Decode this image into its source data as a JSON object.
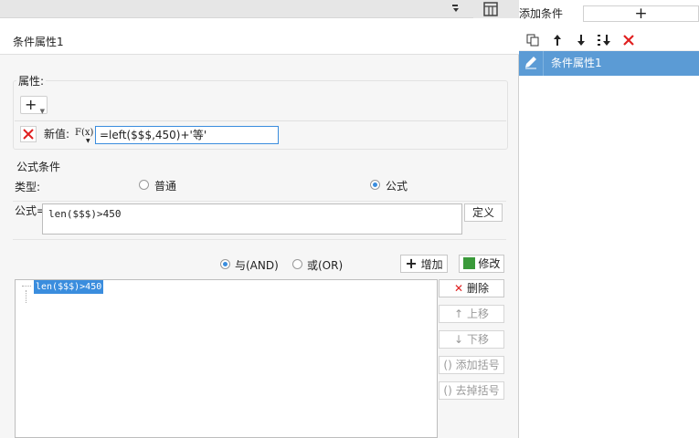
{
  "panel": {
    "title": "条件属性1"
  },
  "attributes": {
    "group_label": "属性:",
    "add_symbol": "+",
    "new_value_label": "新值:",
    "fx_label": "F(x)",
    "new_value_formula": "=left($$$,450)+'等'"
  },
  "formula_condition": {
    "group_label": "公式条件",
    "type_label": "类型:",
    "type_options": [
      "普通",
      "公式"
    ],
    "selected_type": "公式",
    "formula_label": "公式=",
    "formula_value": "len($$$)>450",
    "define_button": "定义",
    "logic_options": [
      "与(AND)",
      "或(OR)"
    ],
    "selected_logic": "与(AND)",
    "add_button": "增加",
    "edit_button": "修改",
    "conditions": [
      "len($$$)>450"
    ],
    "side_buttons": {
      "delete": "删除",
      "move_up": "上移",
      "move_down": "下移",
      "add_parentheses": "添加括号",
      "remove_parentheses": "去掉括号"
    }
  },
  "right_panel": {
    "add_condition_label": "添加条件",
    "add_symbol": "+",
    "items": [
      "条件属性1"
    ]
  },
  "colors": {
    "accent": "#3a8dde",
    "selection": "#5b9bd5",
    "delete_red": "#e02020"
  }
}
